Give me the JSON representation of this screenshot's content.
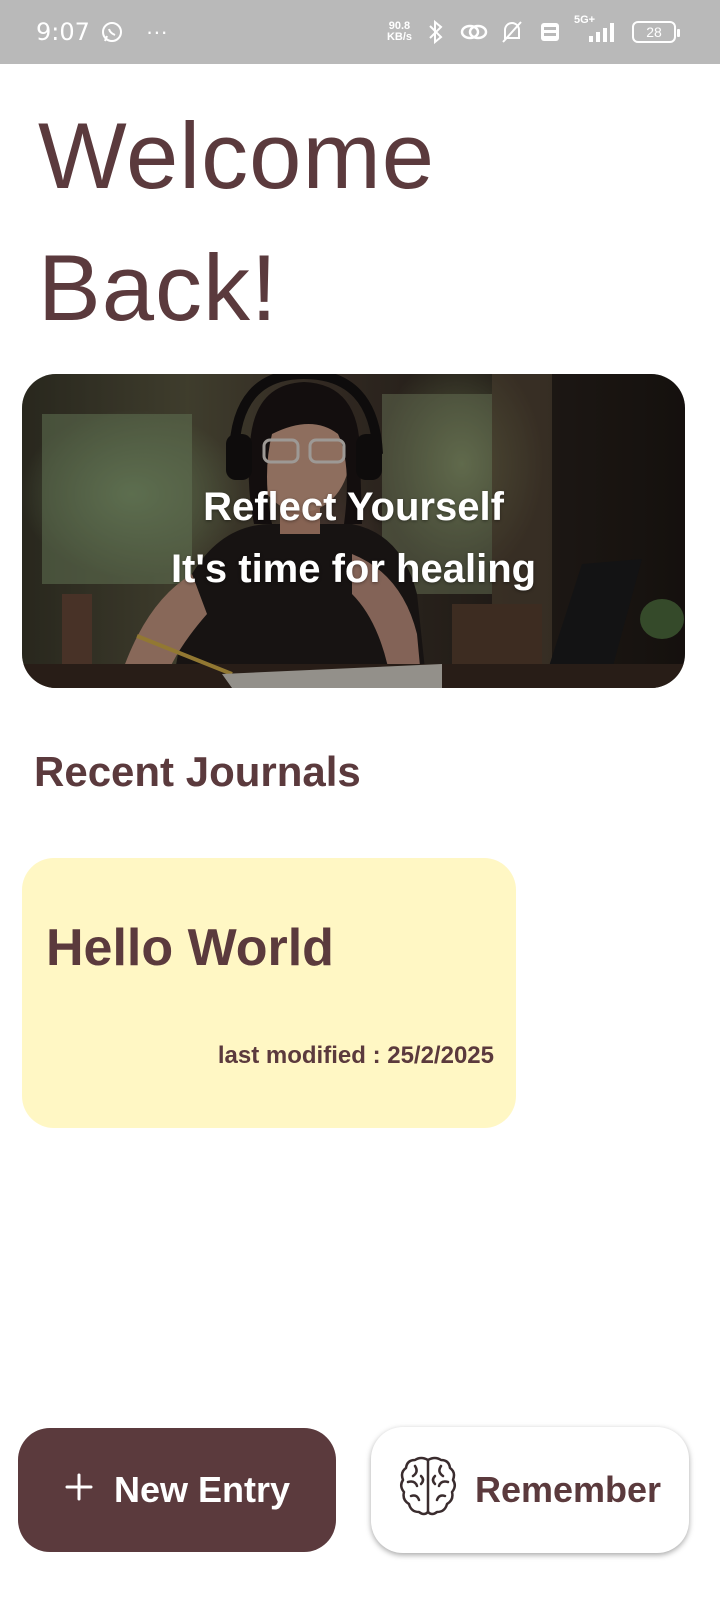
{
  "status_bar": {
    "time": "9:07",
    "more": "···",
    "net_speed_value": "90.8",
    "net_speed_unit": "KB/s",
    "network_label": "5G+",
    "battery": "28",
    "icons": [
      "whatsapp-icon",
      "bluetooth-icon",
      "hotspot-link-icon",
      "bell-muted-icon",
      "volte-icon",
      "signal-icon",
      "battery-icon"
    ]
  },
  "header": {
    "line1": "Welcome",
    "line2": "Back!"
  },
  "hero": {
    "line1": "Reflect Yourself",
    "line2": "It's time for healing"
  },
  "recent": {
    "title": "Recent Journals",
    "items": [
      {
        "title": "Hello World",
        "meta": "last modified : 25/2/2025"
      }
    ]
  },
  "actions": {
    "new_entry": {
      "icon": "plus-icon",
      "label": "New Entry"
    },
    "remember": {
      "icon": "brain-icon",
      "label": "Remember"
    }
  },
  "colors": {
    "primary": "#5b3a3d",
    "card": "#fff7c4",
    "status_bar": "#b9b9b9"
  }
}
